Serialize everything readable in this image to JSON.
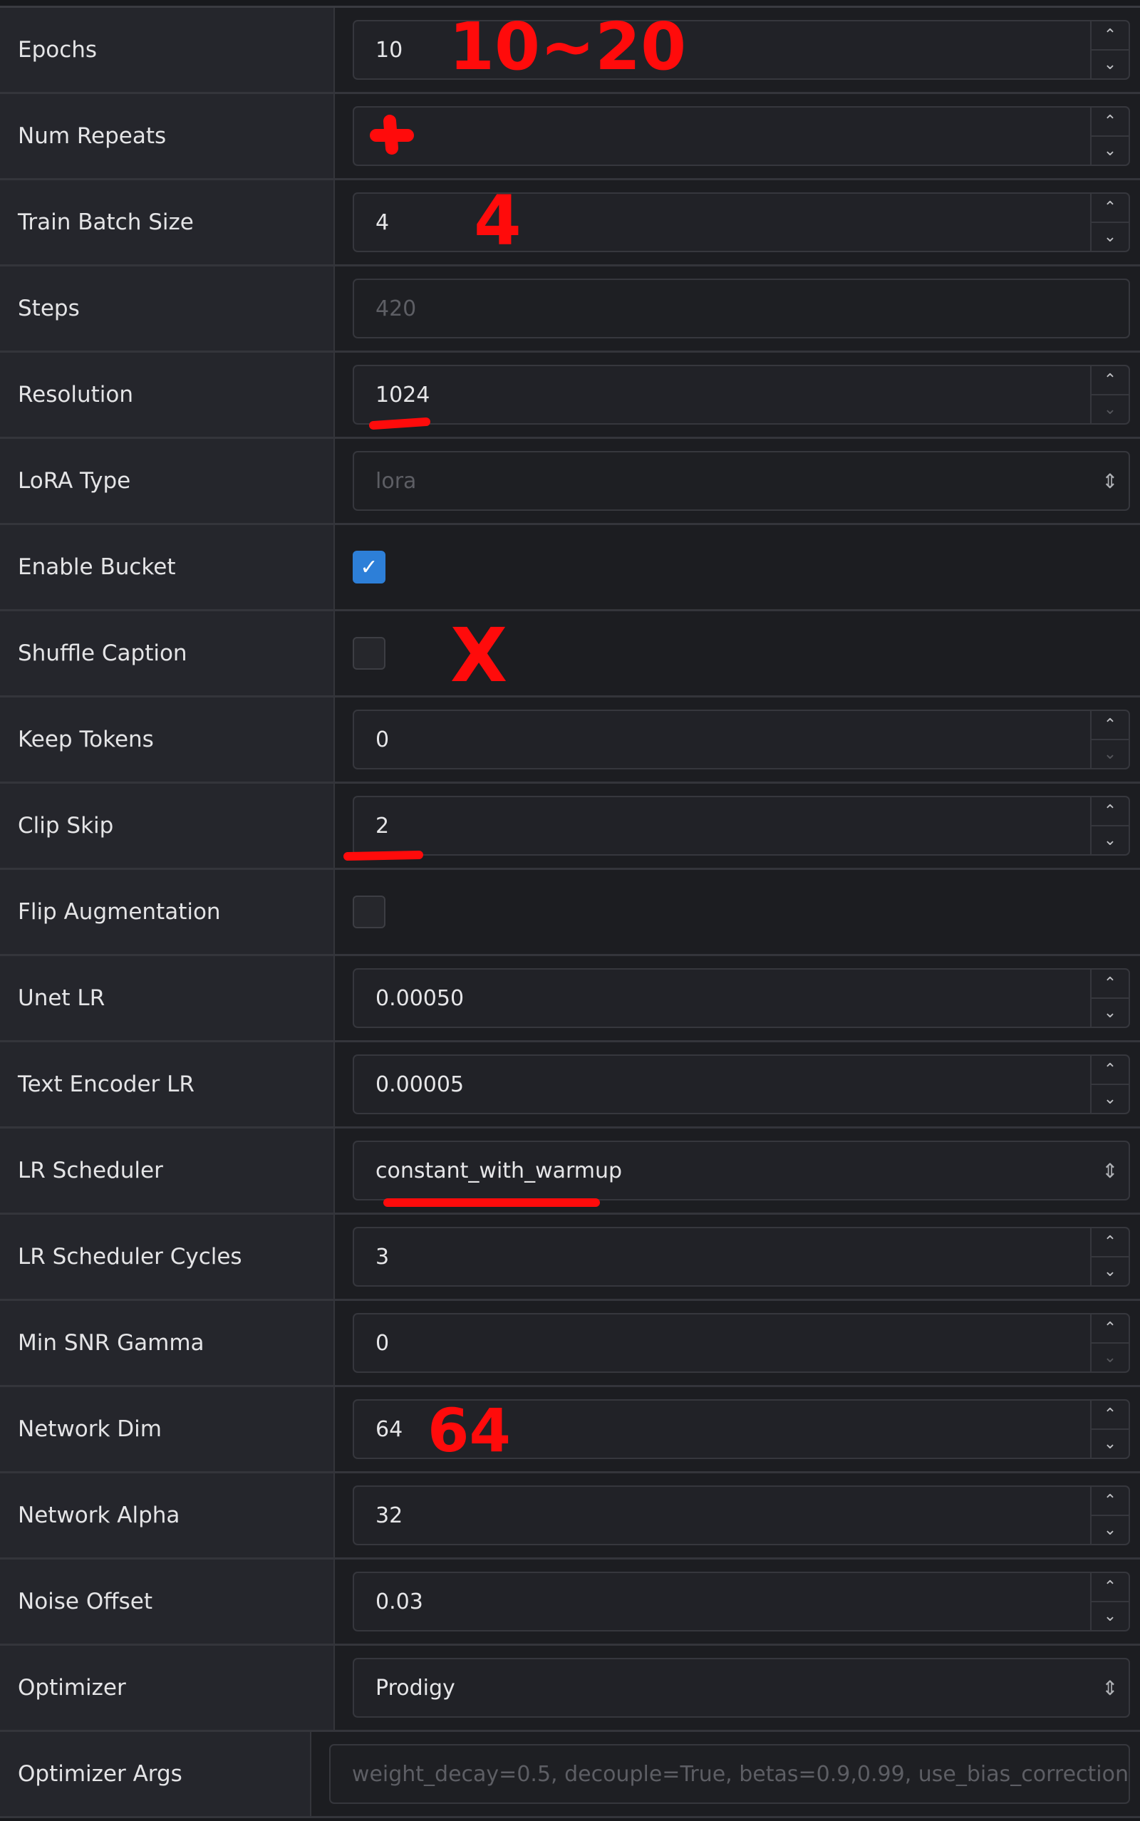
{
  "rows": [
    {
      "label": "Epochs",
      "type": "number",
      "value": "10"
    },
    {
      "label": "Num Repeats",
      "type": "number",
      "value": ""
    },
    {
      "label": "Train Batch Size",
      "type": "number",
      "value": "4"
    },
    {
      "label": "Steps",
      "type": "readonly",
      "value": "420"
    },
    {
      "label": "Resolution",
      "type": "number",
      "value": "1024",
      "down_disabled": true
    },
    {
      "label": "LoRA Type",
      "type": "select-disabled",
      "value": "lora"
    },
    {
      "label": "Enable Bucket",
      "type": "checkbox",
      "checked": true
    },
    {
      "label": "Shuffle Caption",
      "type": "checkbox",
      "checked": false
    },
    {
      "label": "Keep Tokens",
      "type": "number",
      "value": "0",
      "down_disabled": true
    },
    {
      "label": "Clip Skip",
      "type": "number",
      "value": "2"
    },
    {
      "label": "Flip Augmentation",
      "type": "checkbox",
      "checked": false
    },
    {
      "label": "Unet LR",
      "type": "number",
      "value": "0.00050"
    },
    {
      "label": "Text Encoder LR",
      "type": "number",
      "value": "0.00005"
    },
    {
      "label": "LR Scheduler",
      "type": "select",
      "value": "constant_with_warmup"
    },
    {
      "label": "LR Scheduler Cycles",
      "type": "number",
      "value": "3"
    },
    {
      "label": "Min SNR Gamma",
      "type": "number",
      "value": "0",
      "down_disabled": true
    },
    {
      "label": "Network Dim",
      "type": "number",
      "value": "64"
    },
    {
      "label": "Network Alpha",
      "type": "number",
      "value": "32"
    },
    {
      "label": "Noise Offset",
      "type": "number",
      "value": "0.03"
    },
    {
      "label": "Optimizer",
      "type": "select",
      "value": "Prodigy"
    },
    {
      "label": "Optimizer Args",
      "type": "readonly",
      "value": "weight_decay=0.5, decouple=True, betas=0.9,0.99, use_bias_correction"
    }
  ],
  "handwritten_annotations": [
    "10~20",
    "4",
    "X",
    "64"
  ],
  "colors": {
    "annotation": "#ff0b0b",
    "checkbox_checked": "#2d7fd8"
  },
  "icons": {
    "spin_up": "chevron-up-icon",
    "spin_down": "chevron-down-icon",
    "select": "up-down-arrows-icon",
    "check": "check-icon"
  }
}
